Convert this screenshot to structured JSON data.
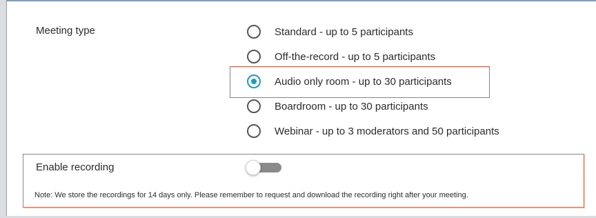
{
  "meeting_type": {
    "label": "Meeting type",
    "selected_index": 2,
    "options": [
      {
        "label": "Standard - up to 5 participants",
        "checked": false
      },
      {
        "label": "Off-the-record - up to 5 participants",
        "checked": false
      },
      {
        "label": "Audio only room - up to 30 participants",
        "checked": true
      },
      {
        "label": "Boardroom - up to 30 participants",
        "checked": false
      },
      {
        "label": "Webinar - up to 3 moderators and 50 participants",
        "checked": false
      }
    ]
  },
  "recording": {
    "label": "Enable recording",
    "enabled": false,
    "note": "Note: We store the recordings for 14 days only. Please remember to request and download the recording right after your meeting."
  },
  "colors": {
    "accent": "#17a2b8",
    "highlight": "#e8603c",
    "toggle_track": "#8a8a8a"
  }
}
